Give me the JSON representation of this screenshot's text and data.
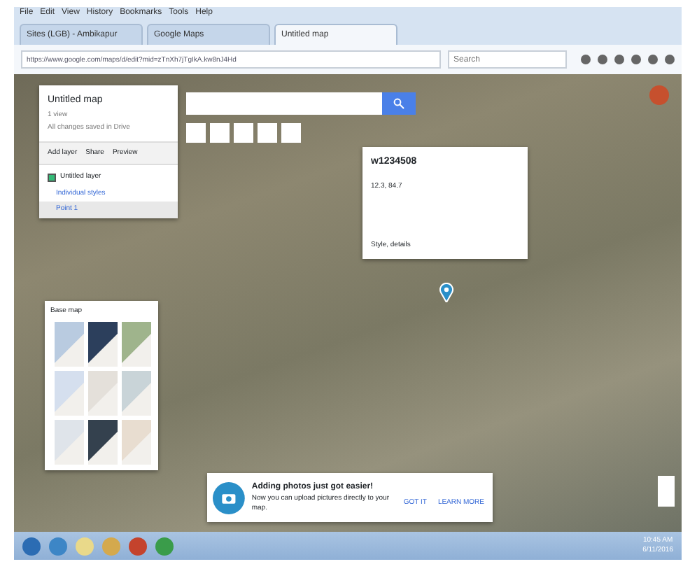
{
  "browser": {
    "menu": [
      "File",
      "Edit",
      "View",
      "History",
      "Bookmarks",
      "Tools",
      "Help"
    ],
    "tabs": [
      {
        "label": "Sites (LGB) - Ambikapur",
        "selected": false
      },
      {
        "label": "Google Maps",
        "selected": false
      },
      {
        "label": "Untitled map",
        "selected": true
      }
    ],
    "url": "https://www.google.com/maps/d/edit?mid=zTnXh7jTgIkA.kw8nJ4Hd",
    "search_placeholder": "Search"
  },
  "map_panel": {
    "title": "Untitled map",
    "subtitle": "1 view",
    "saved": "All changes saved in Drive",
    "actions": [
      "Add layer",
      "Share",
      "Preview"
    ],
    "layer": {
      "name": "Untitled layer",
      "checked": true,
      "items": [
        {
          "label": "Individual styles",
          "selected": false
        },
        {
          "label": "Point 1",
          "selected": true
        }
      ]
    }
  },
  "base_map": {
    "title": "Base map",
    "tiles": [
      {
        "color": "#b9cbe0"
      },
      {
        "color": "#2c3f5c"
      },
      {
        "color": "#9fb48c"
      },
      {
        "color": "#d5dfee"
      },
      {
        "color": "#e4e0da"
      },
      {
        "color": "#c9d4d8"
      },
      {
        "color": "#dfe4ea"
      },
      {
        "color": "#34414e"
      },
      {
        "color": "#e8ddd0"
      }
    ]
  },
  "popup": {
    "title": "w1234508",
    "coords": "12.3, 84.7",
    "footer": "Style, details"
  },
  "notice": {
    "title": "Adding photos just got easier!",
    "body": "Now you can upload pictures directly to your map.",
    "buttons": [
      "GOT IT",
      "LEARN MORE"
    ]
  },
  "taskbar": {
    "time": "10:45 AM",
    "date": "6/11/2016"
  }
}
